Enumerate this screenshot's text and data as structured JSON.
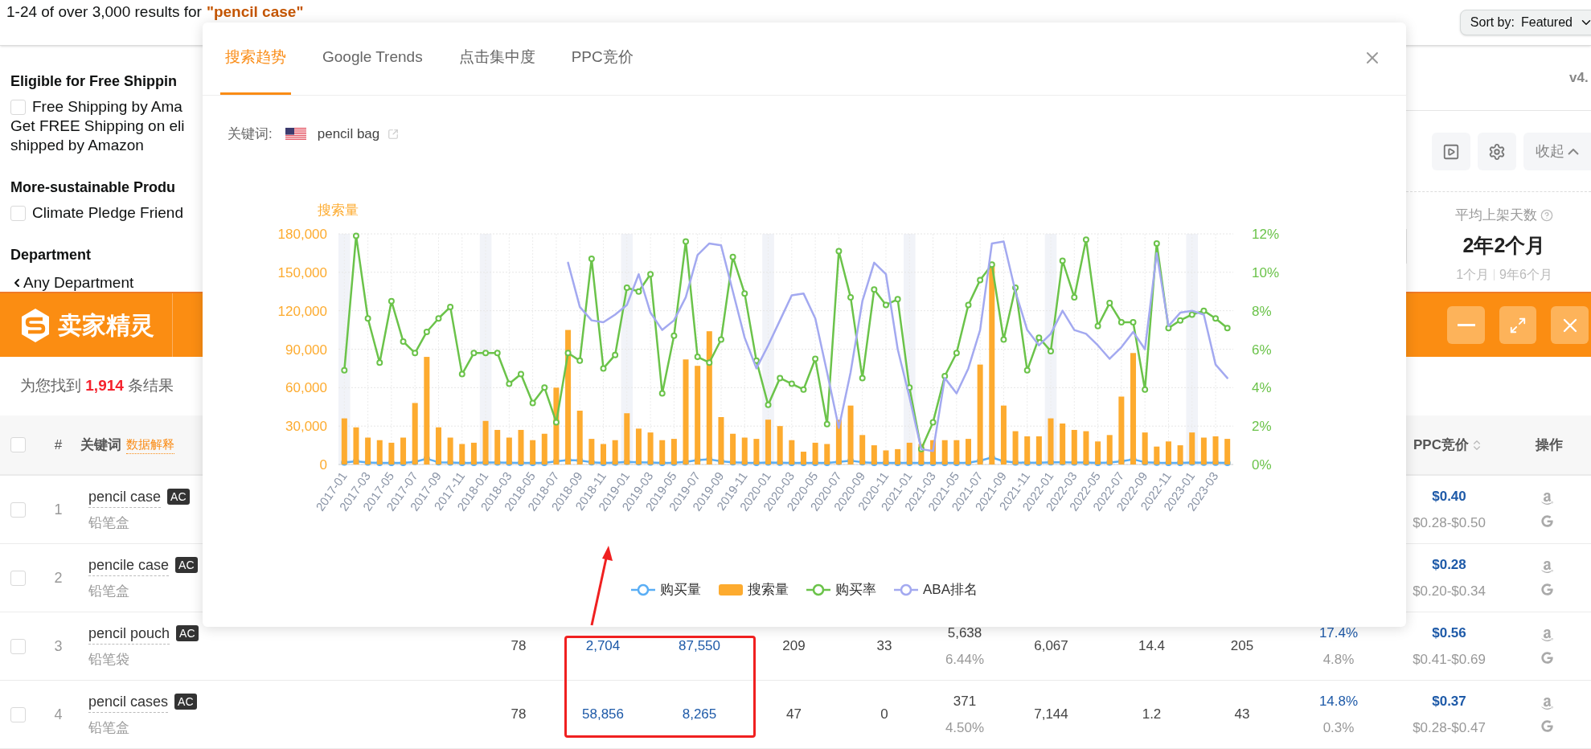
{
  "results_bar": {
    "summary": "1-24 of over 3,000 results for",
    "query": "\"pencil case\"",
    "sort": {
      "label": "Sort by:",
      "value": "Featured"
    }
  },
  "filters": [
    {
      "kind": "heading",
      "text": "Eligible for Free Shippin"
    },
    {
      "kind": "checkbox",
      "text": "Free Shipping by Ama",
      "checked": false
    },
    {
      "kind": "text",
      "text": "Get FREE Shipping on eli"
    },
    {
      "kind": "text",
      "text": "shipped by Amazon"
    },
    {
      "kind": "heading",
      "text": "More-sustainable Produ"
    },
    {
      "kind": "checkbox",
      "text": "Climate Pledge Friend",
      "checked": false
    },
    {
      "kind": "heading",
      "text": "Department"
    },
    {
      "kind": "link",
      "text": "Any Department"
    }
  ],
  "side_panel": {
    "version": "v4.",
    "collapse_button": "收起",
    "stat": {
      "label": "平均上架天数",
      "value": "2年2个月",
      "min": "1个月",
      "max": "9年6个月"
    }
  },
  "extension_bar": {
    "title": "卖家精灵"
  },
  "result_count": {
    "prefix": "为您找到",
    "count": "1,914",
    "suffix": "条结果"
  },
  "table": {
    "header_checked": false,
    "columns": [
      {
        "label": "#"
      },
      {
        "label": "关键词",
        "hint": "数据解释"
      },
      {
        "label": "PPC竞价",
        "sortable": true
      },
      {
        "label": "操作"
      }
    ],
    "rows": [
      {
        "index": "1",
        "keyword": "pencil case",
        "badge": "AC",
        "translation": "铅笔盒",
        "checked": false,
        "ppc": "$0.40",
        "ppc_range": "$0.28-$0.50"
      },
      {
        "index": "2",
        "keyword": "pencile case",
        "badge": "AC",
        "translation": "铅笔盒",
        "checked": false,
        "ppc": "$0.28",
        "ppc_range": "$0.20-$0.34"
      },
      {
        "index": "3",
        "keyword": "pencil pouch",
        "badge": "AC",
        "translation": "铅笔袋",
        "checked": false,
        "values": [
          {
            "main": "78",
            "link": false
          },
          {
            "main": "2,704",
            "link": true
          },
          {
            "main": "87,550",
            "link": true
          },
          {
            "main": "209",
            "link": false
          },
          {
            "main": "33",
            "link": false
          },
          {
            "main": "5,638",
            "sub": "6.44%",
            "link": false
          },
          {
            "main": "6,067",
            "link": false
          },
          {
            "main": "14.4",
            "link": false
          },
          {
            "main": "205",
            "link": false
          },
          {
            "main": "17.4%",
            "sub": "4.8%",
            "link": true
          }
        ],
        "ppc": "$0.56",
        "ppc_range": "$0.41-$0.69"
      },
      {
        "index": "4",
        "keyword": "pencil cases",
        "badge": "AC",
        "translation": "铅笔盒",
        "checked": false,
        "values": [
          {
            "main": "78",
            "link": false
          },
          {
            "main": "58,856",
            "link": true
          },
          {
            "main": "8,265",
            "link": true
          },
          {
            "main": "47",
            "link": false
          },
          {
            "main": "0",
            "link": false
          },
          {
            "main": "371",
            "sub": "4.50%",
            "link": false
          },
          {
            "main": "7,144",
            "link": false
          },
          {
            "main": "1.2",
            "link": false
          },
          {
            "main": "43",
            "link": false
          },
          {
            "main": "14.8%",
            "sub": "0.3%",
            "link": true
          }
        ],
        "ppc": "$0.37",
        "ppc_range": "$0.28-$0.47"
      }
    ]
  },
  "modal": {
    "tabs": [
      {
        "label": "搜索趋势",
        "selected": true
      },
      {
        "label": "Google Trends",
        "selected": false
      },
      {
        "label": "点击集中度",
        "selected": false
      },
      {
        "label": "PPC竞价",
        "selected": false
      }
    ],
    "keyword": {
      "label": "关键词:",
      "value": "pencil bag"
    },
    "chart_data": {
      "type": "bar",
      "grid": true,
      "ylabel": "搜索量",
      "ylim": [
        0,
        180000
      ],
      "y2lim": [
        0,
        12
      ],
      "yticks": [
        {
          "value": 0,
          "label": "0"
        },
        {
          "value": 30000,
          "label": "30,000"
        },
        {
          "value": 60000,
          "label": "60,000"
        },
        {
          "value": 90000,
          "label": "90,000"
        },
        {
          "value": 120000,
          "label": "120,000"
        },
        {
          "value": 150000,
          "label": "150,000"
        },
        {
          "value": 180000,
          "label": "180,000"
        }
      ],
      "y2ticks": [
        {
          "value": 0,
          "label": "0%"
        },
        {
          "value": 2,
          "label": "2%"
        },
        {
          "value": 4,
          "label": "4%"
        },
        {
          "value": 6,
          "label": "6%"
        },
        {
          "value": 8,
          "label": "8%"
        },
        {
          "value": 10,
          "label": "10%"
        },
        {
          "value": 12,
          "label": "12%"
        }
      ],
      "categories": [
        "2017-01",
        null,
        "2017-03",
        null,
        "2017-05",
        null,
        "2017-07",
        null,
        "2017-09",
        null,
        "2017-11",
        null,
        "2018-01",
        null,
        "2018-03",
        null,
        "2018-05",
        null,
        "2018-07",
        null,
        "2018-09",
        null,
        "2018-11",
        null,
        "2019-01",
        null,
        "2019-03",
        null,
        "2019-05",
        null,
        "2019-07",
        null,
        "2019-09",
        null,
        "2019-11",
        null,
        "2020-01",
        null,
        "2020-03",
        null,
        "2020-05",
        null,
        "2020-07",
        null,
        "2020-09",
        null,
        "2020-11",
        null,
        "2021-01",
        null,
        "2021-03",
        null,
        "2021-05",
        null,
        "2021-07",
        null,
        "2021-09",
        null,
        "2021-11",
        null,
        "2022-01",
        null,
        "2022-03",
        null,
        "2022-05",
        null,
        "2022-07",
        null,
        "2022-09",
        null,
        "2022-11",
        null,
        "2023-01",
        null,
        "2023-03",
        null
      ],
      "series": [
        {
          "name": "购买量",
          "color": "#5aaef5",
          "type": "line",
          "marker": "circle",
          "values": [
            1500,
            2500,
            1500,
            1200,
            1200,
            1300,
            2000,
            4500,
            1800,
            1500,
            1200,
            1300,
            1500,
            1500,
            1400,
            1300,
            1200,
            1300,
            2500,
            3500,
            3200,
            1800,
            1300,
            1400,
            2000,
            1800,
            1500,
            1300,
            1400,
            2000,
            3500,
            4000,
            2500,
            1800,
            1400,
            1300,
            1500,
            1400,
            1300,
            1200,
            1200,
            1300,
            2000,
            3000,
            1800,
            1300,
            1200,
            1200,
            1300,
            1200,
            1300,
            1300,
            1300,
            1400,
            3000,
            5500,
            2500,
            1600,
            1400,
            1400,
            1800,
            1700,
            1500,
            1500,
            1300,
            1500,
            2500,
            4000,
            1800,
            1400,
            1300,
            1300,
            1500,
            1400,
            1400,
            1300
          ]
        },
        {
          "name": "搜索量",
          "color": "#fdab2f",
          "type": "bar",
          "values": [
            36000,
            29000,
            21000,
            19000,
            17000,
            21000,
            48000,
            84000,
            29000,
            21000,
            16000,
            17000,
            34000,
            27000,
            21000,
            27000,
            19000,
            24000,
            60000,
            105000,
            42000,
            20000,
            16000,
            19000,
            40000,
            28000,
            25000,
            19000,
            20000,
            82000,
            77000,
            104000,
            37000,
            24000,
            21000,
            20000,
            35000,
            30000,
            19000,
            10000,
            17000,
            16000,
            35000,
            46000,
            23000,
            15000,
            11000,
            12000,
            17000,
            16000,
            19000,
            19000,
            19000,
            20000,
            78000,
            157000,
            46000,
            26000,
            22000,
            22000,
            36000,
            32000,
            27000,
            26000,
            18000,
            23000,
            53000,
            87000,
            25000,
            14000,
            18000,
            15000,
            25000,
            21000,
            22000,
            20000
          ]
        },
        {
          "name": "购买率",
          "color": "#6bc34a",
          "type": "line",
          "marker": "circle",
          "axis": "y2",
          "values": [
            4.9,
            11.9,
            7.6,
            5.3,
            8.5,
            6.4,
            5.8,
            6.9,
            7.6,
            8.2,
            4.7,
            5.8,
            5.8,
            5.8,
            4.2,
            4.7,
            3.2,
            4.0,
            2.2,
            5.8,
            5.4,
            10.7,
            5.0,
            5.7,
            9.2,
            9.0,
            9.9,
            3.7,
            6.7,
            11.6,
            5.6,
            5.3,
            6.5,
            10.8,
            8.9,
            5.4,
            3.1,
            4.5,
            4.2,
            3.9,
            5.5,
            2.1,
            11.1,
            8.7,
            4.5,
            9.1,
            8.3,
            8.6,
            4.0,
            0.8,
            2.2,
            4.6,
            5.8,
            8.3,
            9.6,
            10.4,
            6.5,
            9.2,
            4.9,
            6.6,
            5.9,
            10.6,
            8.7,
            11.7,
            7.2,
            8.4,
            7.4,
            7.4,
            3.9,
            11.5,
            7.1,
            7.5,
            7.8,
            8.0,
            7.6,
            7.1
          ]
        },
        {
          "name": "ABA排名",
          "color": "#a3a9f0",
          "type": "line",
          "marker": "none",
          "axis": "y2",
          "values": [
            null,
            null,
            null,
            null,
            null,
            null,
            null,
            null,
            null,
            null,
            null,
            null,
            null,
            null,
            null,
            null,
            null,
            null,
            null,
            10.5,
            8.2,
            7.5,
            7.4,
            7.8,
            8.3,
            9.9,
            7.9,
            7.0,
            7.5,
            8.7,
            10.9,
            11.5,
            11.4,
            9.0,
            6.6,
            5.0,
            6.2,
            7.5,
            8.8,
            8.9,
            7.6,
            4.8,
            1.9,
            4.8,
            8.5,
            10.5,
            9.9,
            6.0,
            3.5,
            0.8,
            0.7,
            4.5,
            3.7,
            5.0,
            7.0,
            11.5,
            11.6,
            9.0,
            7.0,
            6.2,
            6.8,
            8.0,
            7.0,
            6.8,
            6.2,
            5.5,
            6.1,
            6.9,
            6.0,
            11.0,
            7.2,
            7.9,
            8.0,
            7.8,
            5.2,
            4.5
          ]
        }
      ]
    }
  }
}
